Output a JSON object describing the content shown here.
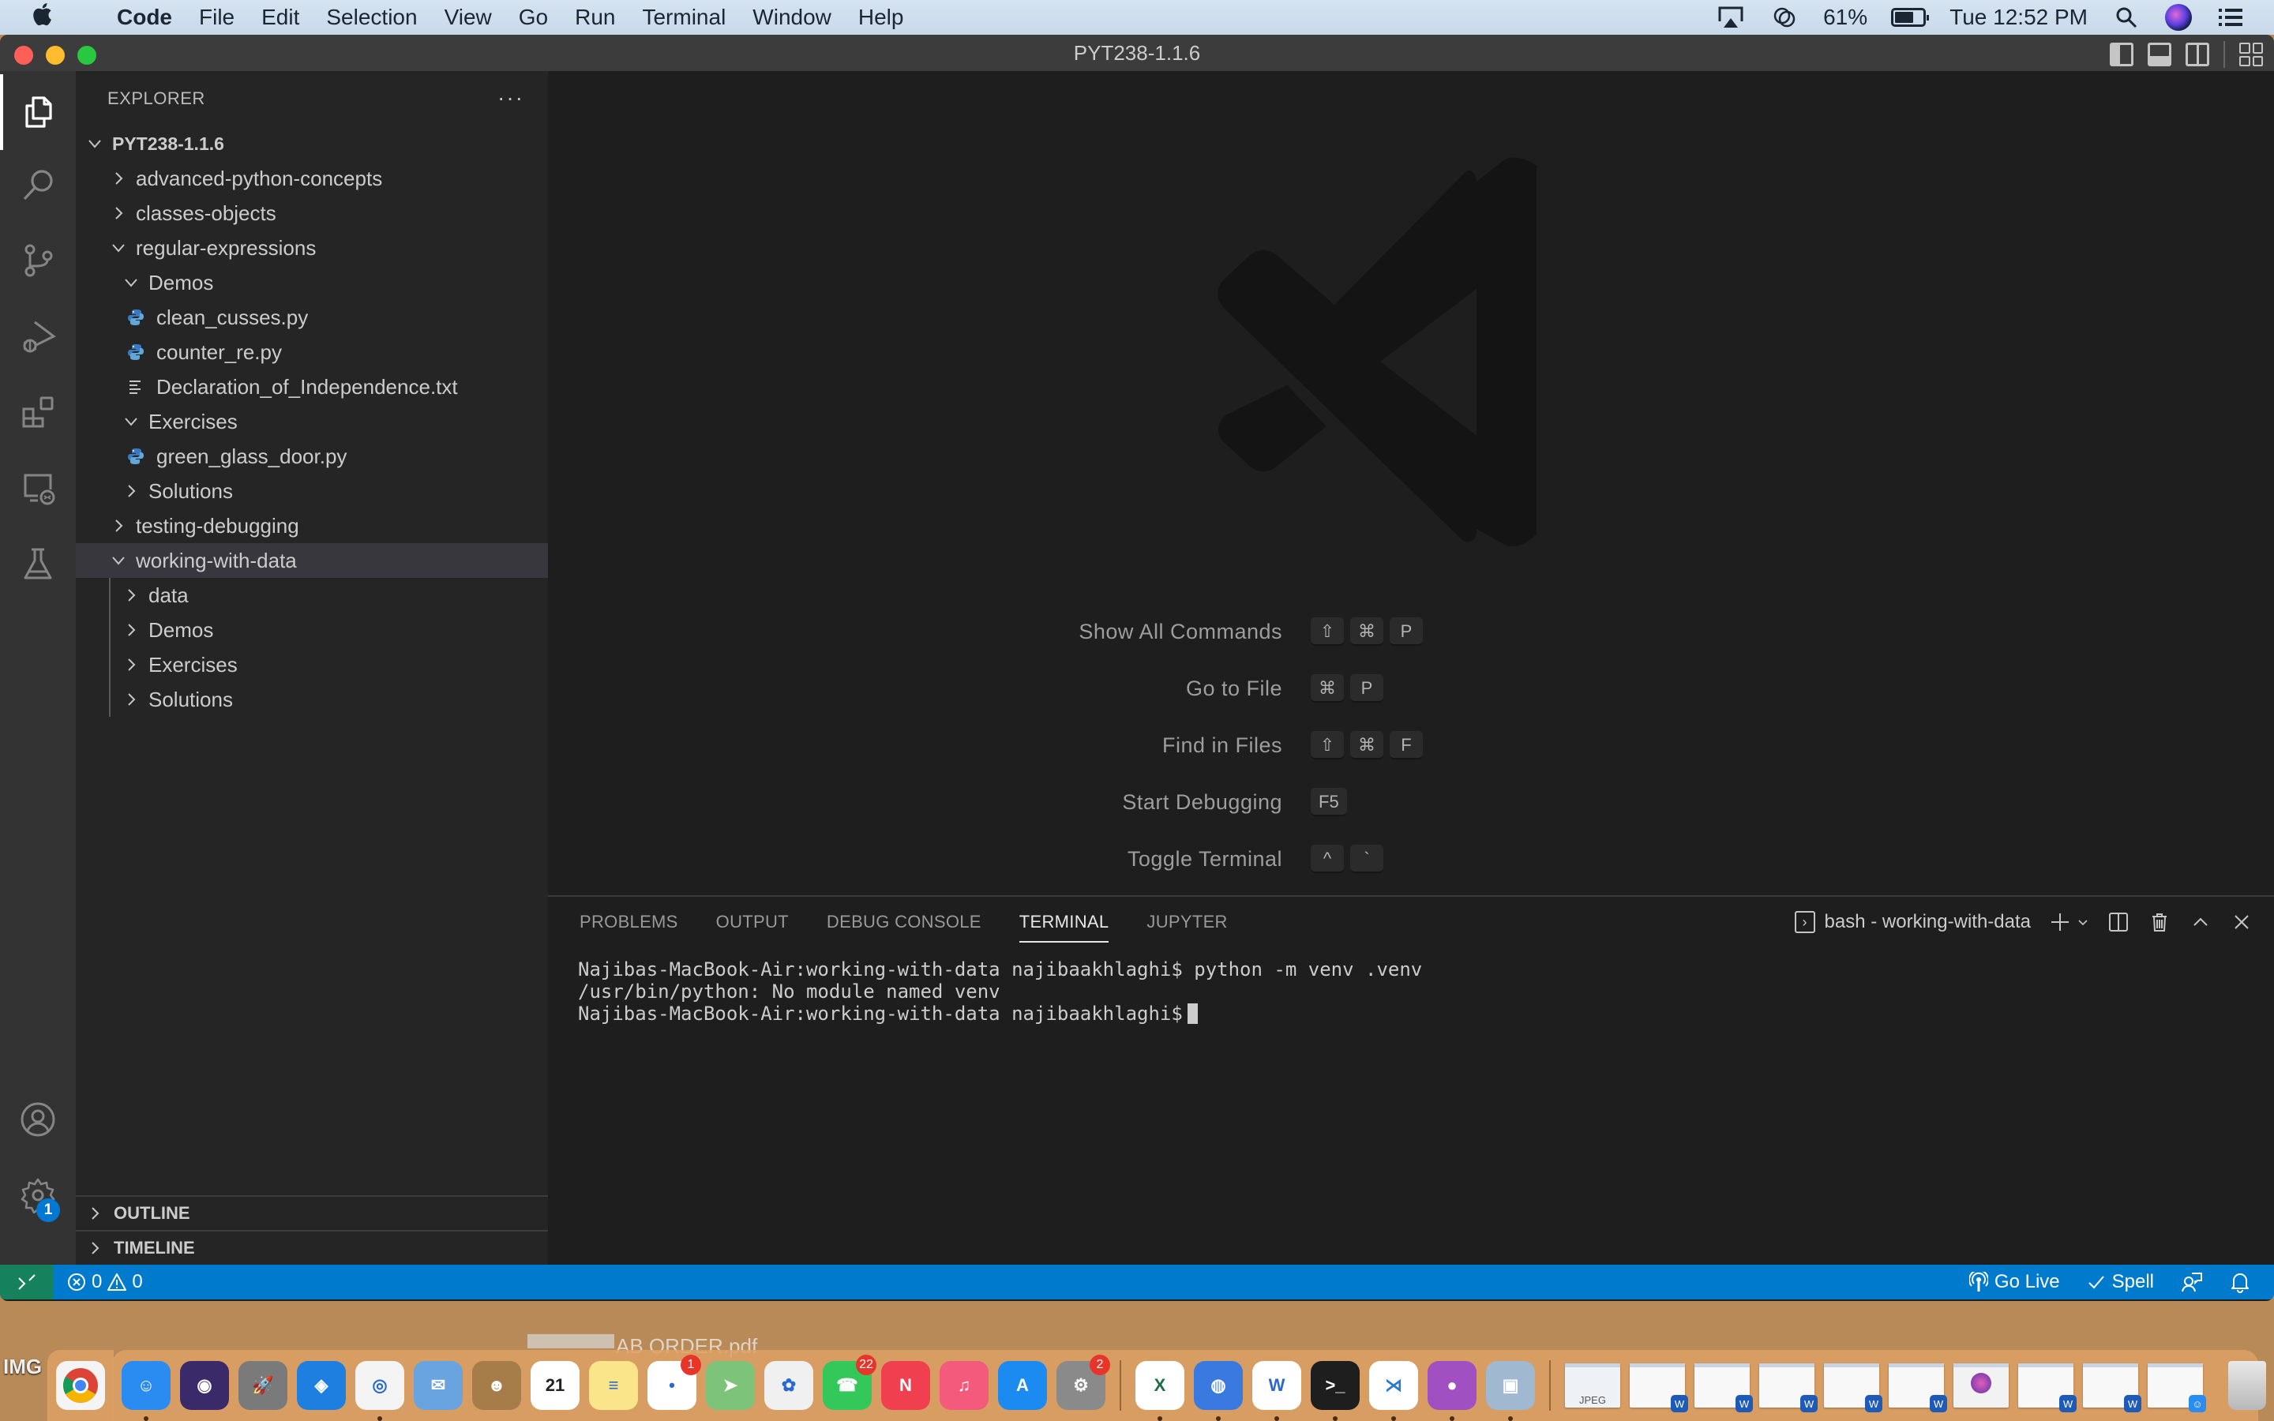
{
  "menubar": {
    "app_name": "Code",
    "menus": [
      "File",
      "Edit",
      "Selection",
      "View",
      "Go",
      "Run",
      "Terminal",
      "Window",
      "Help"
    ],
    "battery_percent": "61%",
    "clock": "Tue 12:52 PM"
  },
  "window": {
    "title": "PYT238-1.1.6"
  },
  "sidebar": {
    "header": "EXPLORER",
    "more_label": "···",
    "root": "PYT238-1.1.6",
    "tree": [
      {
        "label": "advanced-python-concepts",
        "type": "folder",
        "expanded": false,
        "depth": 1
      },
      {
        "label": "classes-objects",
        "type": "folder",
        "expanded": false,
        "depth": 1
      },
      {
        "label": "regular-expressions",
        "type": "folder",
        "expanded": true,
        "depth": 1
      },
      {
        "label": "Demos",
        "type": "folder",
        "expanded": true,
        "depth": 2
      },
      {
        "label": "clean_cusses.py",
        "type": "python",
        "depth": 3
      },
      {
        "label": "counter_re.py",
        "type": "python",
        "depth": 3
      },
      {
        "label": "Declaration_of_Independence.txt",
        "type": "text",
        "depth": 3
      },
      {
        "label": "Exercises",
        "type": "folder",
        "expanded": true,
        "depth": 2
      },
      {
        "label": "green_glass_door.py",
        "type": "python",
        "depth": 3
      },
      {
        "label": "Solutions",
        "type": "folder",
        "expanded": false,
        "depth": 2
      },
      {
        "label": "testing-debugging",
        "type": "folder",
        "expanded": false,
        "depth": 1
      },
      {
        "label": "working-with-data",
        "type": "folder",
        "expanded": true,
        "depth": 1,
        "selected": true
      },
      {
        "label": "data",
        "type": "folder",
        "expanded": false,
        "depth": 2
      },
      {
        "label": "Demos",
        "type": "folder",
        "expanded": false,
        "depth": 2
      },
      {
        "label": "Exercises",
        "type": "folder",
        "expanded": false,
        "depth": 2
      },
      {
        "label": "Solutions",
        "type": "folder",
        "expanded": false,
        "depth": 2
      }
    ],
    "sections": [
      "OUTLINE",
      "TIMELINE"
    ]
  },
  "activitybar": {
    "items": [
      "explorer",
      "search",
      "source-control",
      "run-debug",
      "extensions",
      "remote-explorer",
      "testing"
    ],
    "bottom": [
      "accounts",
      "manage"
    ],
    "manage_badge": "1"
  },
  "editor": {
    "shortcuts": [
      {
        "label": "Show All Commands",
        "keys": [
          "⇧",
          "⌘",
          "P"
        ]
      },
      {
        "label": "Go to File",
        "keys": [
          "⌘",
          "P"
        ]
      },
      {
        "label": "Find in Files",
        "keys": [
          "⇧",
          "⌘",
          "F"
        ]
      },
      {
        "label": "Start Debugging",
        "keys": [
          "F5"
        ]
      },
      {
        "label": "Toggle Terminal",
        "keys": [
          "^",
          "`"
        ]
      }
    ]
  },
  "panel": {
    "tabs": [
      "PROBLEMS",
      "OUTPUT",
      "DEBUG CONSOLE",
      "TERMINAL",
      "JUPYTER"
    ],
    "active_tab": "TERMINAL",
    "terminal_name": "bash - working-with-data",
    "terminal_lines": [
      "Najibas-MacBook-Air:working-with-data najibaakhlaghi$ python -m venv .venv",
      "/usr/bin/python: No module named venv",
      "Najibas-MacBook-Air:working-with-data najibaakhlaghi$"
    ]
  },
  "statusbar": {
    "errors": "0",
    "warnings": "0",
    "go_live": "Go Live",
    "spell": "Spell"
  },
  "desktop": {
    "left_label": "IMG",
    "file_label": "AB ORDER.pdf"
  },
  "dock": {
    "apps": [
      {
        "name": "Finder",
        "color": "#2a8cf0",
        "glyph": "☺",
        "running": true
      },
      {
        "name": "Siri",
        "color": "#3a2a6a",
        "glyph": "◉"
      },
      {
        "name": "Launchpad",
        "color": "#7a7a7a",
        "glyph": "🚀"
      },
      {
        "name": "Safari",
        "color": "#1f7fe0",
        "glyph": "◈"
      },
      {
        "name": "Google Chrome",
        "color": "#f4f4f4",
        "glyph": "◎",
        "running": true
      },
      {
        "name": "Mail",
        "color": "#6aa4e0",
        "glyph": "✉"
      },
      {
        "name": "Contacts",
        "color": "#a67c48",
        "glyph": "☻"
      },
      {
        "name": "Calendar",
        "color": "#ffffff",
        "glyph": "21"
      },
      {
        "name": "Notes",
        "color": "#fbe58a",
        "glyph": "≡"
      },
      {
        "name": "Reminders",
        "color": "#ffffff",
        "glyph": "•",
        "badge": "1"
      },
      {
        "name": "Maps",
        "color": "#7dc47a",
        "glyph": "➤"
      },
      {
        "name": "Photos",
        "color": "#f0f0f0",
        "glyph": "✿"
      },
      {
        "name": "FaceTime",
        "color": "#34c759",
        "glyph": "☎",
        "badge": "22"
      },
      {
        "name": "News",
        "color": "#f04050",
        "glyph": "N"
      },
      {
        "name": "Music",
        "color": "#f35a7c",
        "glyph": "♫"
      },
      {
        "name": "App Store",
        "color": "#1b8bf2",
        "glyph": "A"
      },
      {
        "name": "System Preferences",
        "color": "#8a8a8a",
        "glyph": "⚙",
        "badge": "2"
      }
    ],
    "running_apps": [
      {
        "name": "Microsoft Excel",
        "color": "#ffffff",
        "glyph": "X",
        "running": true
      },
      {
        "name": "Network Utility",
        "color": "#3a7ae0",
        "glyph": "◍",
        "running": true
      },
      {
        "name": "Microsoft Word",
        "color": "#ffffff",
        "glyph": "W",
        "running": true
      },
      {
        "name": "Terminal",
        "color": "#1e1e1e",
        "glyph": ">_",
        "running": true
      },
      {
        "name": "Visual Studio Code",
        "color": "#ffffff",
        "glyph": "⋊",
        "running": true
      },
      {
        "name": "Install macOS Monterey",
        "color": "#a050c0",
        "glyph": "●",
        "running": true
      },
      {
        "name": "Preview",
        "color": "#a0b8d0",
        "glyph": "▣",
        "running": true
      }
    ],
    "stack_items": [
      "JPEG",
      "doc",
      "doc",
      "doc",
      "doc",
      "doc",
      "macOS",
      "doc",
      "doc",
      "finder-window"
    ],
    "trash_label": "Trash"
  }
}
